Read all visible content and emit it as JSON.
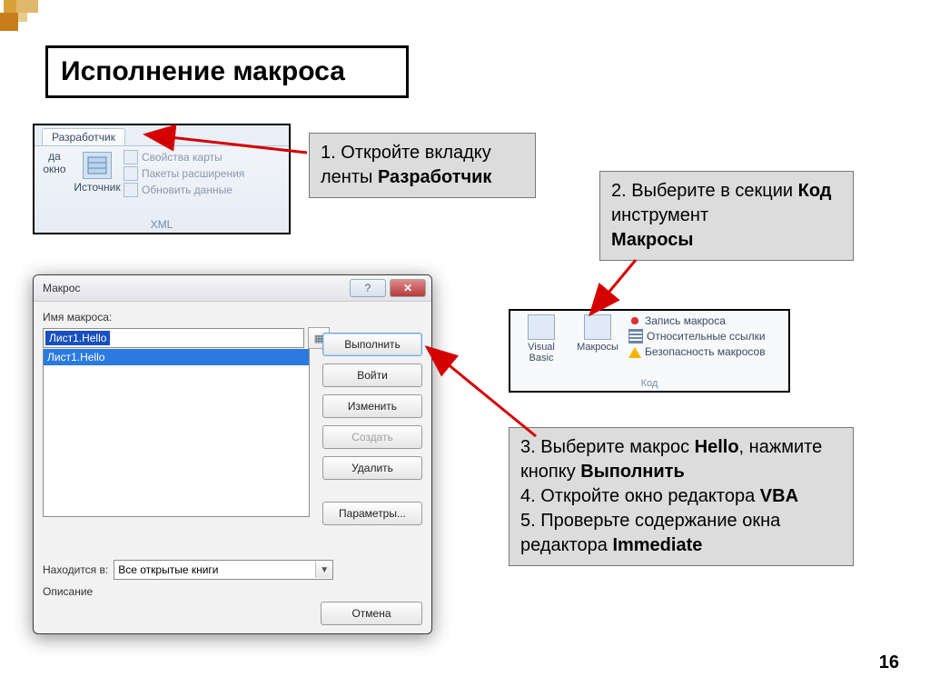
{
  "title": "Исполнение макроса",
  "page_number": "16",
  "callout1": {
    "line1": "1. Откройте вкладку ленты ",
    "bold1": "Разработчик"
  },
  "callout2": {
    "line1": "2. Выберите в секции ",
    "bold1": "Код",
    "line2": " инструмент ",
    "bold2": "Макросы"
  },
  "callout3": {
    "l1a": "3. Выберите макрос ",
    "l1b": "Hello",
    "l1c": ", нажмите кнопку ",
    "l1d": "Выполнить",
    "l2a": "4. Откройте окно редактора ",
    "l2b": "VBA",
    "l3a": "5. Проверьте  содержание окна редактора ",
    "l3b": "Immediate"
  },
  "ribbon": {
    "tab": "Разработчик",
    "left_partial1": "да",
    "left_partial2": "окно",
    "source_btn": "Источник",
    "item_map_properties": "Свойства карты",
    "item_expansion_packs": "Пакеты расширения",
    "item_refresh_data": "Обновить данные",
    "group": "XML"
  },
  "code_group": {
    "visual_basic": "Visual Basic",
    "macros": "Макросы",
    "record_macro": "Запись макроса",
    "relative_refs": "Относительные ссылки",
    "macro_security": "Безопасность макросов",
    "group": "Код"
  },
  "dialog": {
    "title": "Макрос",
    "help": "?",
    "close": "✕",
    "name_label": "Имя макроса:",
    "name_value": "Лист1.Hello",
    "list_selected": "Лист1.Hello",
    "btn_execute": "Выполнить",
    "btn_stepin": "Войти",
    "btn_edit": "Изменить",
    "btn_create": "Создать",
    "btn_delete": "Удалить",
    "btn_params": "Параметры...",
    "location_label": "Находится в:",
    "location_value": "Все открытые книги",
    "description_label": "Описание",
    "btn_cancel": "Отмена"
  }
}
